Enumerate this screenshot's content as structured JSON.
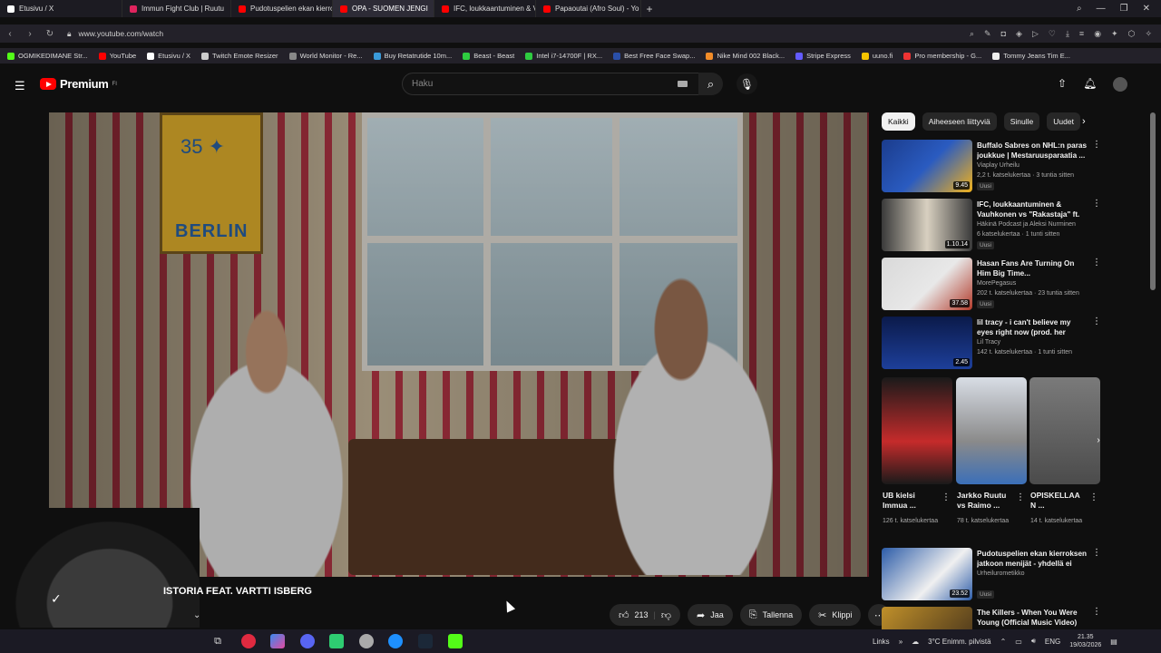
{
  "browser": {
    "tabs": [
      {
        "label": "Etusivu / X",
        "color": "#000000"
      },
      {
        "label": "Immun Fight Club | Ruutu",
        "color": "#e0245e"
      },
      {
        "label": "Pudotuspelien ekan kierro",
        "color": "#ff0000"
      },
      {
        "label": "OPA - SUOMEN JENGI",
        "color": "#ff0000",
        "active": true
      },
      {
        "label": "IFC, loukkaantuminen & V",
        "color": "#ff0000"
      },
      {
        "label": "Papaoutai (Afro Soul) - Yo",
        "color": "#ff0000"
      }
    ],
    "url": "www.youtube.com/watch",
    "bookmarks": [
      "OGMIKEDIMANE Str...",
      "YouTube",
      "Etusivu / X",
      "Twitch Emote Resizer",
      "World Monitor - Re...",
      "Buy Retatrutide 10m...",
      "Beast - Beast",
      "Intel i7-14700F | RX...",
      "Best Free Face Swap...",
      "Nike Mind 002 Black...",
      "Stripe Express",
      "uuno.fi",
      "Pro membership - G...",
      "Tommy Jeans Tim E..."
    ]
  },
  "header": {
    "logo_text": "Premium",
    "logo_sup": "FI",
    "search_placeholder": "Haku"
  },
  "video": {
    "title": "ISTORIA FEAT. VARTTI ISBERG",
    "like_count": "213",
    "share_label": "Jaa",
    "save_label": "Tallenna",
    "clip_label": "Klippi"
  },
  "chips": [
    "Kaikki",
    "Aiheeseen liittyviä",
    "Sinulle",
    "Uudet"
  ],
  "recommendations": [
    {
      "title": "Buffalo Sabres on NHL:n paras joukkue | Mestaruusparaatia ...",
      "channel": "Viaplay Urheilu",
      "meta": "2,2 t. katselukertaa · 3 tuntia sitten",
      "badge": "Uusi",
      "duration": "9.45",
      "thumb_colors": [
        "#1b3c8c",
        "#f2b21b"
      ]
    },
    {
      "title": "IFC, loukkaantuminen & Vauhkonen vs \"Rakastaja\" ft. ...",
      "channel": "Häkinä Podcast ja Aleksi Nurminen",
      "meta": "6 katselukertaa · 1 tunti sitten",
      "badge": "Uusi",
      "duration": "1.10.14",
      "thumb_colors": [
        "#3a3a3a",
        "#d8d0c0"
      ]
    },
    {
      "title": "Hasan Fans Are Turning On Him Big Time...",
      "channel": "MorePegasus",
      "meta": "202 t. katselukertaa · 23 tuntia sitten",
      "badge": "Uusi",
      "duration": "37.58",
      "thumb_colors": [
        "#d9d9d9",
        "#b23a2a"
      ]
    },
    {
      "title": "lil tracy - i can't believe my eyes right now (prod. her blood)",
      "channel": "Lil Tracy",
      "meta": "142 t. katselukertaa · 1 tunti sitten",
      "badge": "",
      "duration": "2.45",
      "thumb_colors": [
        "#0b1a4a",
        "#1d3f9a"
      ]
    }
  ],
  "shorts": [
    {
      "title": "UB kielsi Immua ...",
      "views": "126 t. katselukertaa",
      "colors": [
        "#1a1a1a",
        "#c52b2b"
      ]
    },
    {
      "title": "Jarkko Ruutu vs Raimo ...",
      "views": "78 t. katselukertaa",
      "colors": [
        "#d8dde5",
        "#3b6fb8"
      ]
    },
    {
      "title": "OPISKELLAA N ...",
      "views": "14 t. katselukertaa",
      "colors": [
        "#4b4b4b",
        "#7a7a7a"
      ]
    }
  ],
  "rec_bottom": [
    {
      "title": "Pudotuspelien ekan kierroksen jatkoon menijät - yhdellä ei riit...",
      "channel": "Urheilurometikko",
      "meta": "",
      "badge": "Uusi",
      "duration": "23.52",
      "thumb_colors": [
        "#2c5ca8",
        "#f0f0f0"
      ]
    },
    {
      "title": "The Killers - When You Were Young (Official Music Video)",
      "channel": "",
      "meta": "",
      "badge": "",
      "duration": "",
      "thumb_colors": [
        "#c0902a",
        "#3a2a1a"
      ]
    }
  ],
  "taskbar": {
    "links_label": "Links",
    "weather": "3°C  Enimm. pilvistä",
    "lang": "ENG",
    "time": "21.35",
    "date": "19/03/2026"
  }
}
